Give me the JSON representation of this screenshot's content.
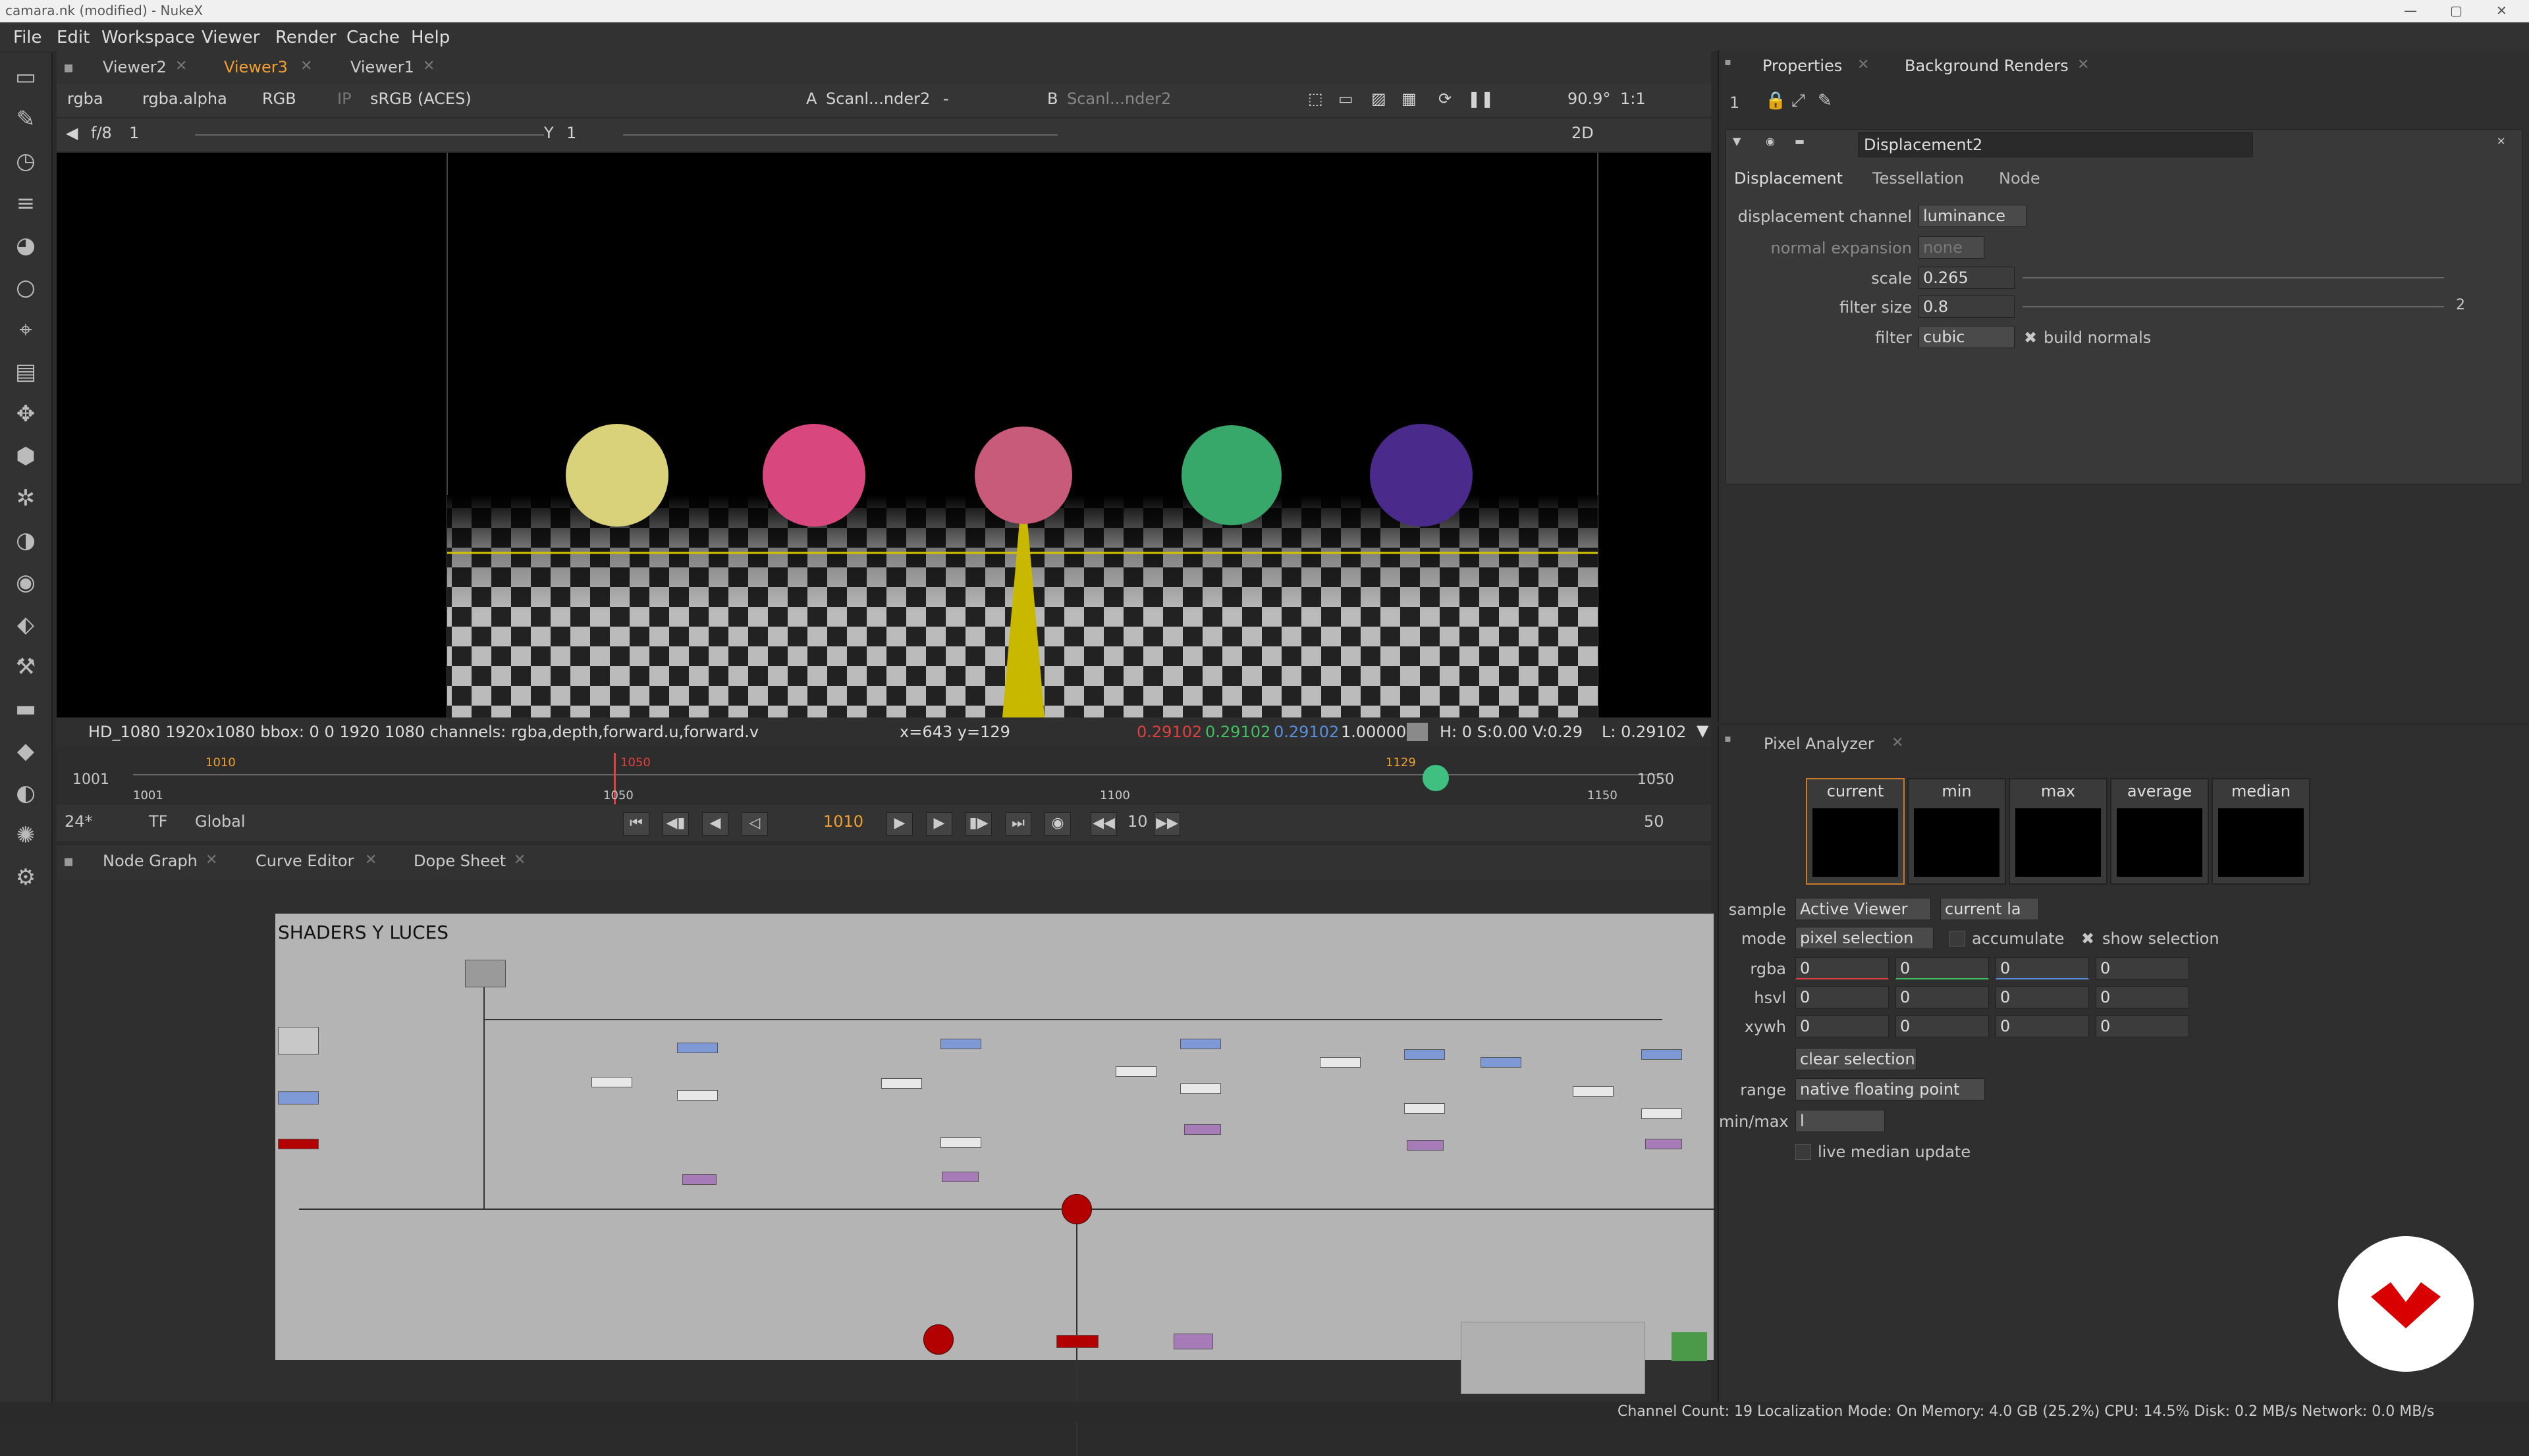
{
  "window": {
    "title": "camara.nk (modified) - NukeX"
  },
  "menu": [
    "File",
    "Edit",
    "Workspace",
    "Viewer",
    "Render",
    "Cache",
    "Help"
  ],
  "viewer_tabs": [
    {
      "label": "Viewer2"
    },
    {
      "label": "Viewer3"
    },
    {
      "label": "Viewer1"
    }
  ],
  "viewer_controls": {
    "channels": "rgba",
    "alpha": "rgba.alpha",
    "colorspace": "RGB",
    "ip": "IP",
    "display": "sRGB (ACES)",
    "input_a_label": "A",
    "input_a": "Scanl...nder2",
    "input_dash": "-",
    "input_b_label": "B",
    "input_b": "Scanl...nder2",
    "zoom": "90.9°",
    "ratio": "1:1",
    "fstop": "f/8",
    "frame_a": "1",
    "y_label": "Y",
    "y_value": "1",
    "view_mode": "2D"
  },
  "viewer_info": {
    "format": "HD_1080 1920x1080  bbox: 0 0 1920 1080 channels: rgba,depth,forward.u,forward.v",
    "coords": "x=643 y=129",
    "r": "0.29102",
    "g": "0.29102",
    "b": "0.29102",
    "a": "1.00000",
    "hsv": "H:   0 S:0.00 V:0.29",
    "lum": "L: 0.29102"
  },
  "timeline": {
    "in": "1001",
    "out": "1050",
    "tick1": "1001",
    "tick2": "1050",
    "tick3": "1100",
    "tick4": "1150",
    "mark1": "1010",
    "mark2": "1050",
    "mark3": "1129"
  },
  "playbar": {
    "fps": "24*",
    "tf": "TF",
    "scope": "Global",
    "current_frame": "1010",
    "step": "10",
    "end": "50"
  },
  "node_tabs": [
    {
      "label": "Node Graph"
    },
    {
      "label": "Curve Editor"
    },
    {
      "label": "Dope Sheet"
    }
  ],
  "graph": {
    "backdrop_label": "SHADERS Y LUCES"
  },
  "properties": {
    "tabs": [
      {
        "label": "Properties"
      },
      {
        "label": "Background Renders"
      }
    ],
    "count": "1",
    "node_name": "Displacement2",
    "subtabs": [
      "Displacement",
      "Tessellation",
      "Node"
    ],
    "fields": {
      "displacement_channel_label": "displacement channel",
      "displacement_channel": "luminance",
      "normal_expansion_label": "normal expansion",
      "normal_expansion": "none",
      "scale_label": "scale",
      "scale": "0.265",
      "filter_size_label": "filter size",
      "filter_size": "0.8",
      "filter_label": "filter",
      "filter": "cubic",
      "build_normals": "build normals"
    },
    "scale_ticks": [
      "0",
      "0.01",
      "0.05",
      "0.1",
      "0.2",
      "0.3",
      "0.4",
      "0.5",
      "0.6",
      "0.7",
      "0.8",
      "0.9",
      "1"
    ],
    "size_ticks": [
      "0",
      "1",
      "5",
      "10",
      "20",
      "30",
      "40",
      "50",
      "60",
      "70",
      "80",
      "90",
      "100"
    ],
    "filter_size_extra": "2"
  },
  "pixel_analyzer": {
    "title": "Pixel Analyzer",
    "swatches": [
      "current",
      "min",
      "max",
      "average",
      "median"
    ],
    "sample_label": "sample",
    "sample": "Active Viewer",
    "sample2": "current la",
    "mode_label": "mode",
    "mode": "pixel selection",
    "accumulate": "accumulate",
    "show_selection": "show selection",
    "rows": [
      {
        "label": "rgba",
        "values": [
          "0",
          "0",
          "0",
          "0"
        ]
      },
      {
        "label": "hsvl",
        "values": [
          "0",
          "0",
          "0",
          "0"
        ]
      },
      {
        "label": "xywh",
        "values": [
          "0",
          "0",
          "0",
          "0"
        ]
      }
    ],
    "clear": "clear selection",
    "range_label": "range",
    "range": "native floating point",
    "minmax_label": "min/max",
    "minmax": "l",
    "live_median": "live median update"
  },
  "status": "Channel Count: 19  Localization Mode: On  Memory: 4.0 GB (25.2%)  CPU: 14.5%  Disk: 0.2 MB/s  Network: 0.0 MB/s",
  "colors": {
    "accent": "#f0a030",
    "red": "#e04040",
    "green": "#40c060",
    "blue": "#5a8fe0"
  }
}
